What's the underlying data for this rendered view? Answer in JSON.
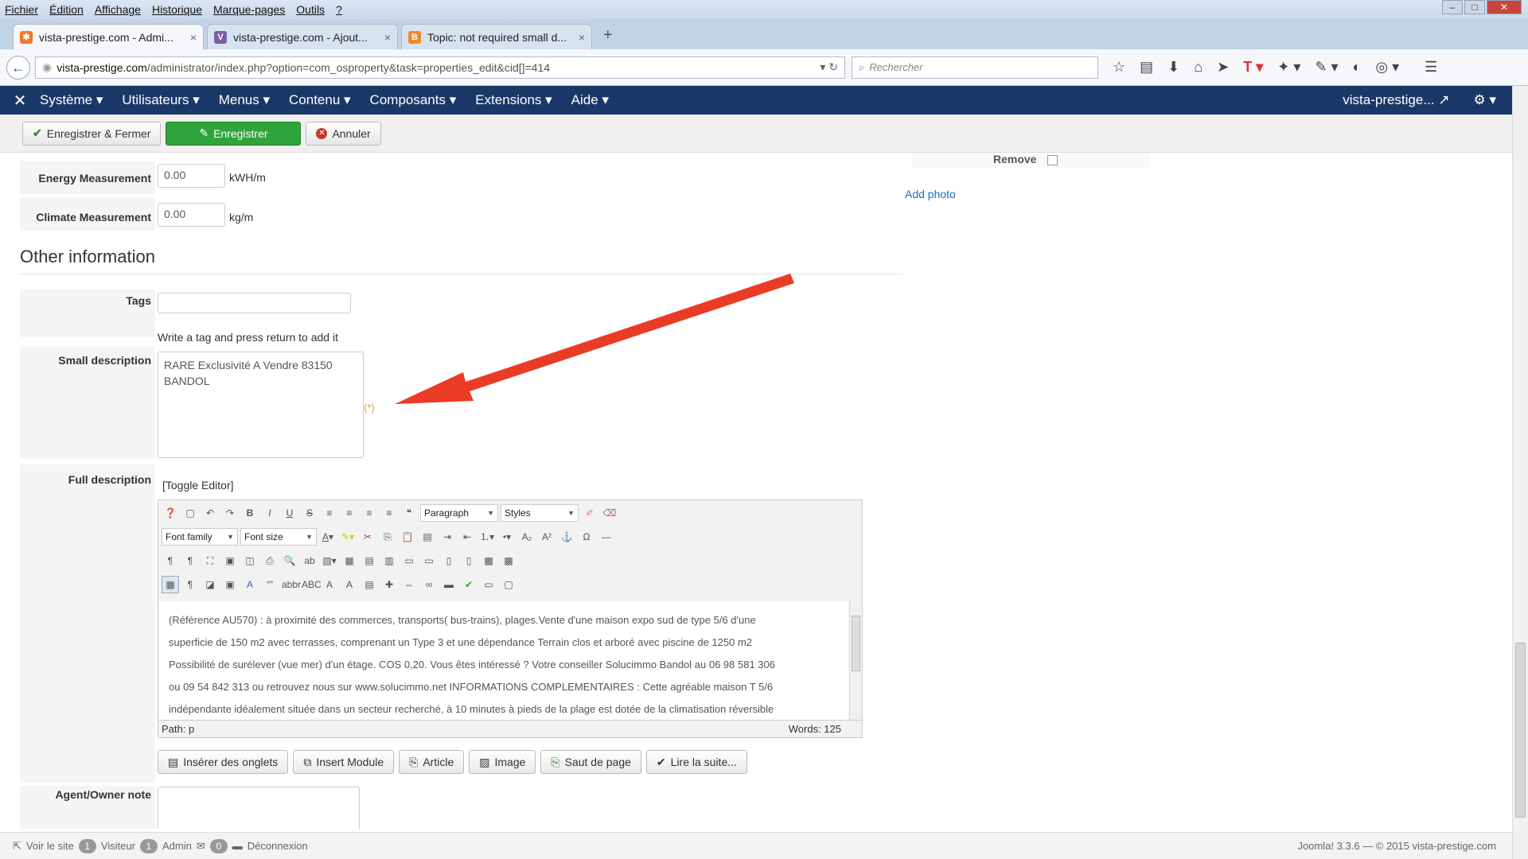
{
  "browser": {
    "menu": [
      "Fichier",
      "Édition",
      "Affichage",
      "Historique",
      "Marque-pages",
      "Outils",
      "?"
    ],
    "tabs": [
      {
        "title": "vista-prestige.com - Admi...",
        "close": "×"
      },
      {
        "title": "vista-prestige.com - Ajout...",
        "close": "×"
      },
      {
        "title": "Topic: not required small d...",
        "close": "×"
      }
    ],
    "new_tab": "+",
    "url_host": "vista-prestige.com",
    "url_path": "/administrator/index.php?option=com_osproperty&task=properties_edit&cid[]=414",
    "search_placeholder": "Rechercher"
  },
  "joomla_nav": {
    "items": [
      "Système ▾",
      "Utilisateurs ▾",
      "Menus ▾",
      "Contenu ▾",
      "Composants ▾",
      "Extensions ▾",
      "Aide ▾"
    ],
    "site_link": "vista-prestige...",
    "settings": "⚙ ▾"
  },
  "toolbar": {
    "save_close": "Enregistrer & Fermer",
    "save": "Enregistrer",
    "cancel": "Annuler"
  },
  "form": {
    "remove_label": "Remove",
    "add_photo": "Add photo",
    "energy": {
      "label": "Energy Measurement",
      "value": "0.00",
      "unit": "kWH/m"
    },
    "climate": {
      "label": "Climate Measurement",
      "value": "0.00",
      "unit": "kg/m"
    },
    "section_title": "Other information",
    "tags": {
      "label": "Tags",
      "value": "",
      "help": "Write a tag and press return to add it"
    },
    "small_description": {
      "label": "Small description",
      "value": "RARE Exclusivité A Vendre 83150 BANDOL",
      "required_marker": "(*)"
    },
    "full_description": {
      "label": "Full description",
      "toggle": "[Toggle Editor]",
      "format_select": "Paragraph",
      "styles_select": "Styles",
      "font_family": "Font family",
      "font_size": "Font size",
      "lines": [
        "(Référence AU570)  : à proximité des commerces, transports( bus-trains), plages.Vente d'une maison expo sud de type 5/6 d'une",
        "superficie de 150 m2 avec terrasses, comprenant un Type 3 et une dépendance  Terrain clos et arboré avec piscine de 1250 m2",
        "Possibilité de surélever (vue mer) d'un étage. COS 0,20. Vous êtes intéressé ? Votre conseiller Solucimmo Bandol au 06 98 581 306",
        "ou 09 54 842 313 ou retrouvez nous sur www.solucimmo.net  INFORMATIONS COMPLEMENTAIRES : Cette agréable maison T 5/6",
        "indépendante idéalement située dans un secteur recherché, à 10 minutes à pieds de la plage est dotée de la climatisation réversible"
      ],
      "path": "Path:  p",
      "words": "Words:  125"
    },
    "editor_buttons": [
      "Insérer des onglets",
      "Insert Module",
      "Article",
      "Image",
      "Saut de page",
      "Lire la suite..."
    ],
    "agent_note": {
      "label": "Agent/Owner note",
      "value": ""
    }
  },
  "statusbar": {
    "view_site": "Voir le site",
    "visitors_count": "1",
    "visitors_label": "Visiteur",
    "admin_count": "1",
    "admin_label": "Admin",
    "messages_count": "0",
    "logout": "Déconnexion",
    "footer": "Joomla! 3.3.6  —  © 2015 vista-prestige.com"
  },
  "colors": {
    "nav_bg": "#1a3867",
    "save_green": "#2fa43a",
    "annotation_arrow": "#ec3b24",
    "link": "#1c6fb5"
  }
}
